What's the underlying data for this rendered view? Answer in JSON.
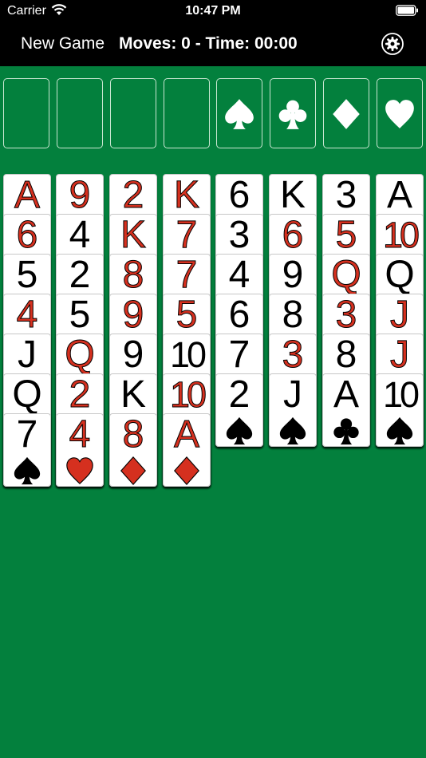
{
  "status_bar": {
    "carrier": "Carrier",
    "time": "10:47 PM"
  },
  "toolbar": {
    "new_game_label": "New Game",
    "game_info": "Moves: 0 - Time: 00:00",
    "settings_icon": "gear-icon"
  },
  "free_cells": [
    {
      "name": "free-cell-1"
    },
    {
      "name": "free-cell-2"
    },
    {
      "name": "free-cell-3"
    },
    {
      "name": "free-cell-4"
    }
  ],
  "foundations": [
    {
      "suit": "spade"
    },
    {
      "suit": "club"
    },
    {
      "suit": "diamond"
    },
    {
      "suit": "heart"
    }
  ],
  "columns": [
    [
      {
        "rank": "A",
        "suit": "heart"
      },
      {
        "rank": "6",
        "suit": "heart"
      },
      {
        "rank": "5",
        "suit": "spade"
      },
      {
        "rank": "4",
        "suit": "heart"
      },
      {
        "rank": "J",
        "suit": "spade"
      },
      {
        "rank": "Q",
        "suit": "spade"
      },
      {
        "rank": "7",
        "suit": "spade"
      }
    ],
    [
      {
        "rank": "9",
        "suit": "heart"
      },
      {
        "rank": "4",
        "suit": "spade"
      },
      {
        "rank": "2",
        "suit": "spade"
      },
      {
        "rank": "5",
        "suit": "spade"
      },
      {
        "rank": "Q",
        "suit": "heart"
      },
      {
        "rank": "2",
        "suit": "heart"
      },
      {
        "rank": "4",
        "suit": "heart"
      }
    ],
    [
      {
        "rank": "2",
        "suit": "heart"
      },
      {
        "rank": "K",
        "suit": "heart"
      },
      {
        "rank": "8",
        "suit": "heart"
      },
      {
        "rank": "9",
        "suit": "heart"
      },
      {
        "rank": "9",
        "suit": "spade"
      },
      {
        "rank": "K",
        "suit": "spade"
      },
      {
        "rank": "8",
        "suit": "diamond"
      }
    ],
    [
      {
        "rank": "K",
        "suit": "heart"
      },
      {
        "rank": "7",
        "suit": "heart"
      },
      {
        "rank": "7",
        "suit": "heart"
      },
      {
        "rank": "5",
        "suit": "heart"
      },
      {
        "rank": "10",
        "suit": "spade"
      },
      {
        "rank": "10",
        "suit": "heart"
      },
      {
        "rank": "A",
        "suit": "diamond"
      }
    ],
    [
      {
        "rank": "6",
        "suit": "spade"
      },
      {
        "rank": "3",
        "suit": "spade"
      },
      {
        "rank": "4",
        "suit": "spade"
      },
      {
        "rank": "6",
        "suit": "spade"
      },
      {
        "rank": "7",
        "suit": "spade"
      },
      {
        "rank": "2",
        "suit": "spade"
      }
    ],
    [
      {
        "rank": "K",
        "suit": "spade"
      },
      {
        "rank": "6",
        "suit": "heart"
      },
      {
        "rank": "9",
        "suit": "spade"
      },
      {
        "rank": "8",
        "suit": "spade"
      },
      {
        "rank": "3",
        "suit": "heart"
      },
      {
        "rank": "J",
        "suit": "spade"
      }
    ],
    [
      {
        "rank": "3",
        "suit": "spade"
      },
      {
        "rank": "5",
        "suit": "heart"
      },
      {
        "rank": "Q",
        "suit": "heart"
      },
      {
        "rank": "3",
        "suit": "heart"
      },
      {
        "rank": "8",
        "suit": "spade"
      },
      {
        "rank": "A",
        "suit": "club"
      }
    ],
    [
      {
        "rank": "A",
        "suit": "spade"
      },
      {
        "rank": "10",
        "suit": "heart"
      },
      {
        "rank": "Q",
        "suit": "spade"
      },
      {
        "rank": "J",
        "suit": "heart"
      },
      {
        "rank": "J",
        "suit": "heart"
      },
      {
        "rank": "10",
        "suit": "spade"
      }
    ]
  ],
  "colors": {
    "table": "#03803d",
    "red_suit": "#d5301f",
    "black_suit": "#000000",
    "bar": "#000000"
  }
}
